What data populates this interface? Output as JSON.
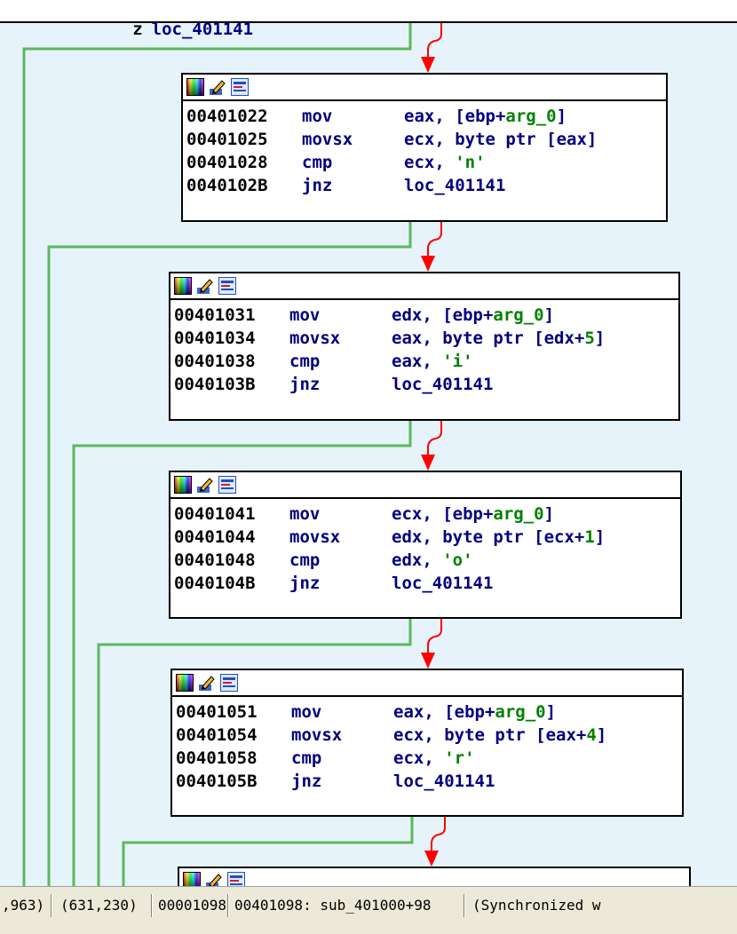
{
  "top_partial": {
    "mnemonic": "z",
    "operand": "loc_401141"
  },
  "blocks": [
    {
      "lines": [
        {
          "addr": "00401022",
          "mn": "mov",
          "op_pre": "eax, [ebp+",
          "op_g": "arg_0",
          "op_post": "]"
        },
        {
          "addr": "00401025",
          "mn": "movsx",
          "op_pre": "ecx, byte ptr [eax]",
          "op_g": "",
          "op_post": ""
        },
        {
          "addr": "00401028",
          "mn": "cmp",
          "op_pre": "ecx, ",
          "op_g": "'n'",
          "op_post": ""
        },
        {
          "addr": "0040102B",
          "mn": "jnz",
          "op_pre": "loc_401141",
          "op_g": "",
          "op_post": ""
        }
      ]
    },
    {
      "lines": [
        {
          "addr": "00401031",
          "mn": "mov",
          "op_pre": "edx, [ebp+",
          "op_g": "arg_0",
          "op_post": "]"
        },
        {
          "addr": "00401034",
          "mn": "movsx",
          "op_pre": "eax, byte ptr [edx+",
          "op_g": "5",
          "op_post": "]"
        },
        {
          "addr": "00401038",
          "mn": "cmp",
          "op_pre": "eax, ",
          "op_g": "'i'",
          "op_post": ""
        },
        {
          "addr": "0040103B",
          "mn": "jnz",
          "op_pre": "loc_401141",
          "op_g": "",
          "op_post": ""
        }
      ]
    },
    {
      "lines": [
        {
          "addr": "00401041",
          "mn": "mov",
          "op_pre": "ecx, [ebp+",
          "op_g": "arg_0",
          "op_post": "]"
        },
        {
          "addr": "00401044",
          "mn": "movsx",
          "op_pre": "edx, byte ptr [ecx+",
          "op_g": "1",
          "op_post": "]"
        },
        {
          "addr": "00401048",
          "mn": "cmp",
          "op_pre": "edx, ",
          "op_g": "'o'",
          "op_post": ""
        },
        {
          "addr": "0040104B",
          "mn": "jnz",
          "op_pre": "loc_401141",
          "op_g": "",
          "op_post": ""
        }
      ]
    },
    {
      "lines": [
        {
          "addr": "00401051",
          "mn": "mov",
          "op_pre": "eax, [ebp+",
          "op_g": "arg_0",
          "op_post": "]"
        },
        {
          "addr": "00401054",
          "mn": "movsx",
          "op_pre": "ecx, byte ptr [eax+",
          "op_g": "4",
          "op_post": "]"
        },
        {
          "addr": "00401058",
          "mn": "cmp",
          "op_pre": "ecx, ",
          "op_g": "'r'",
          "op_post": ""
        },
        {
          "addr": "0040105B",
          "mn": "jnz",
          "op_pre": "loc_401141",
          "op_g": "",
          "op_post": ""
        }
      ]
    },
    {
      "lines": []
    }
  ],
  "status": {
    "s1": ",963)",
    "s2": "(631,230)",
    "s3": "00001098",
    "s4": "00401098: sub_401000+98",
    "s5": "(Synchronized w"
  },
  "colors": {
    "graph_bg": "#e6f3fa",
    "false_edge": "#ff0000",
    "true_edge": "#5cb85c",
    "immediate": "#008000",
    "code_text": "#000080"
  },
  "icons": [
    "color-palette-icon",
    "edit-pencil-icon",
    "graph-list-icon"
  ]
}
